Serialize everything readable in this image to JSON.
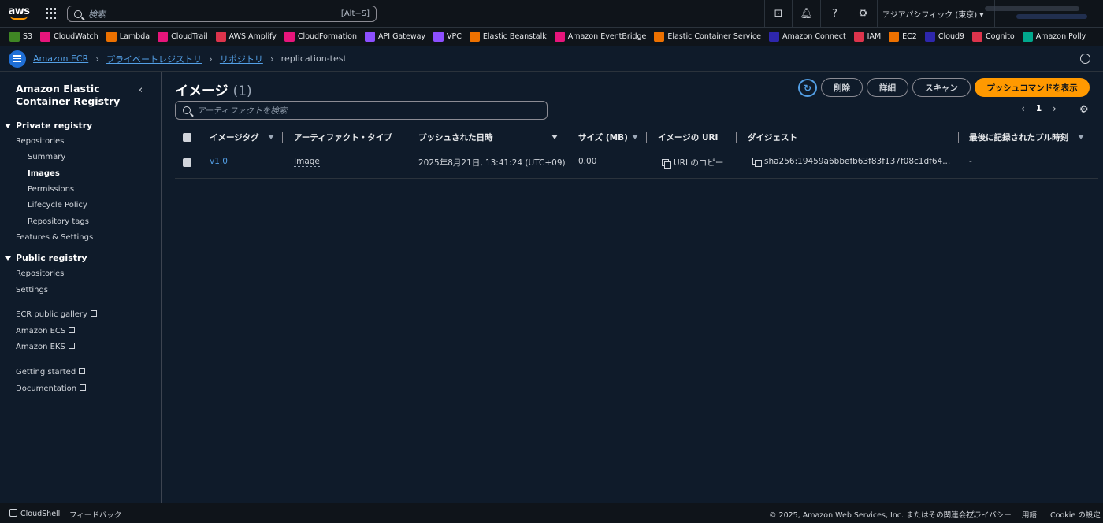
{
  "topbar": {
    "logo_text": "aws",
    "search_placeholder": "検索",
    "search_shortcut": "[Alt+S]",
    "region_label": "アジアパシフィック (東京) ▾"
  },
  "services": [
    {
      "label": "S3",
      "color": "#3f8624",
      "icon": "bucket-icon"
    },
    {
      "label": "CloudWatch",
      "color": "#e7157b",
      "icon": "cloudwatch-icon"
    },
    {
      "label": "Lambda",
      "color": "#ed7100",
      "icon": "lambda-icon"
    },
    {
      "label": "CloudTrail",
      "color": "#e7157b",
      "icon": "cloudtrail-icon"
    },
    {
      "label": "AWS Amplify",
      "color": "#dd344c",
      "icon": "amplify-icon"
    },
    {
      "label": "CloudFormation",
      "color": "#e7157b",
      "icon": "cloudformation-icon"
    },
    {
      "label": "API Gateway",
      "color": "#8c4fff",
      "icon": "api-gateway-icon"
    },
    {
      "label": "VPC",
      "color": "#8c4fff",
      "icon": "vpc-icon"
    },
    {
      "label": "Elastic Beanstalk",
      "color": "#ed7100",
      "icon": "beanstalk-icon"
    },
    {
      "label": "Amazon EventBridge",
      "color": "#e7157b",
      "icon": "eventbridge-icon"
    },
    {
      "label": "Elastic Container Service",
      "color": "#ed7100",
      "icon": "ecs-icon"
    },
    {
      "label": "Amazon Connect",
      "color": "#2e27ad",
      "icon": "connect-icon"
    },
    {
      "label": "IAM",
      "color": "#dd344c",
      "icon": "iam-icon"
    },
    {
      "label": "EC2",
      "color": "#ed7100",
      "icon": "ec2-icon"
    },
    {
      "label": "Cloud9",
      "color": "#2e27ad",
      "icon": "cloud9-icon"
    },
    {
      "label": "Cognito",
      "color": "#dd344c",
      "icon": "cognito-icon"
    },
    {
      "label": "Amazon Polly",
      "color": "#01a88d",
      "icon": "polly-icon"
    }
  ],
  "breadcrumb": {
    "items": [
      "Amazon ECR",
      "プライベートレジストリ",
      "リポジトリ"
    ],
    "current": "replication-test"
  },
  "sidebar": {
    "title": "Amazon Elastic Container Registry",
    "private_registry": "Private registry",
    "private_items": {
      "repositories": "Repositories",
      "summary": "Summary",
      "images": "Images",
      "permissions": "Permissions",
      "lifecycle": "Lifecycle Policy",
      "repo_tags": "Repository tags",
      "features": "Features & Settings"
    },
    "public_registry": "Public registry",
    "public_items": {
      "repositories": "Repositories",
      "settings": "Settings"
    },
    "links": {
      "gallery": "ECR public gallery",
      "ecs": "Amazon ECS",
      "eks": "Amazon EKS",
      "getting_started": "Getting started",
      "documentation": "Documentation"
    }
  },
  "main": {
    "title": "イメージ",
    "count": "(1)",
    "buttons": {
      "delete": "削除",
      "details": "詳細",
      "scan": "スキャン",
      "push": "プッシュコマンドを表示"
    },
    "filter_placeholder": "アーティファクトを検索",
    "page_number": "1",
    "columns": {
      "tag": "イメージタグ",
      "artifact_type": "アーティファクト・タイプ",
      "pushed_at": "プッシュされた日時",
      "size": "サイズ (MB)",
      "uri": "イメージの URI",
      "digest": "ダイジェスト",
      "last_pull": "最後に記録されたプル時刻"
    },
    "rows": [
      {
        "tag": "v1.0",
        "artifact_type": "Image",
        "pushed_at": "2025年8月21日, 13:41:24 (UTC+09)",
        "size": "0.00",
        "uri": "URI のコピー",
        "digest": "sha256:19459a6bbefb63f83f137f08c1df64...",
        "last_pull": "-"
      }
    ]
  },
  "footer": {
    "cloudshell": "CloudShell",
    "feedback": "フィードバック",
    "copyright": "© 2025, Amazon Web Services, Inc. またはその関連会社。",
    "privacy": "プライバシー",
    "terms": "用語",
    "cookie": "Cookie の設定"
  }
}
